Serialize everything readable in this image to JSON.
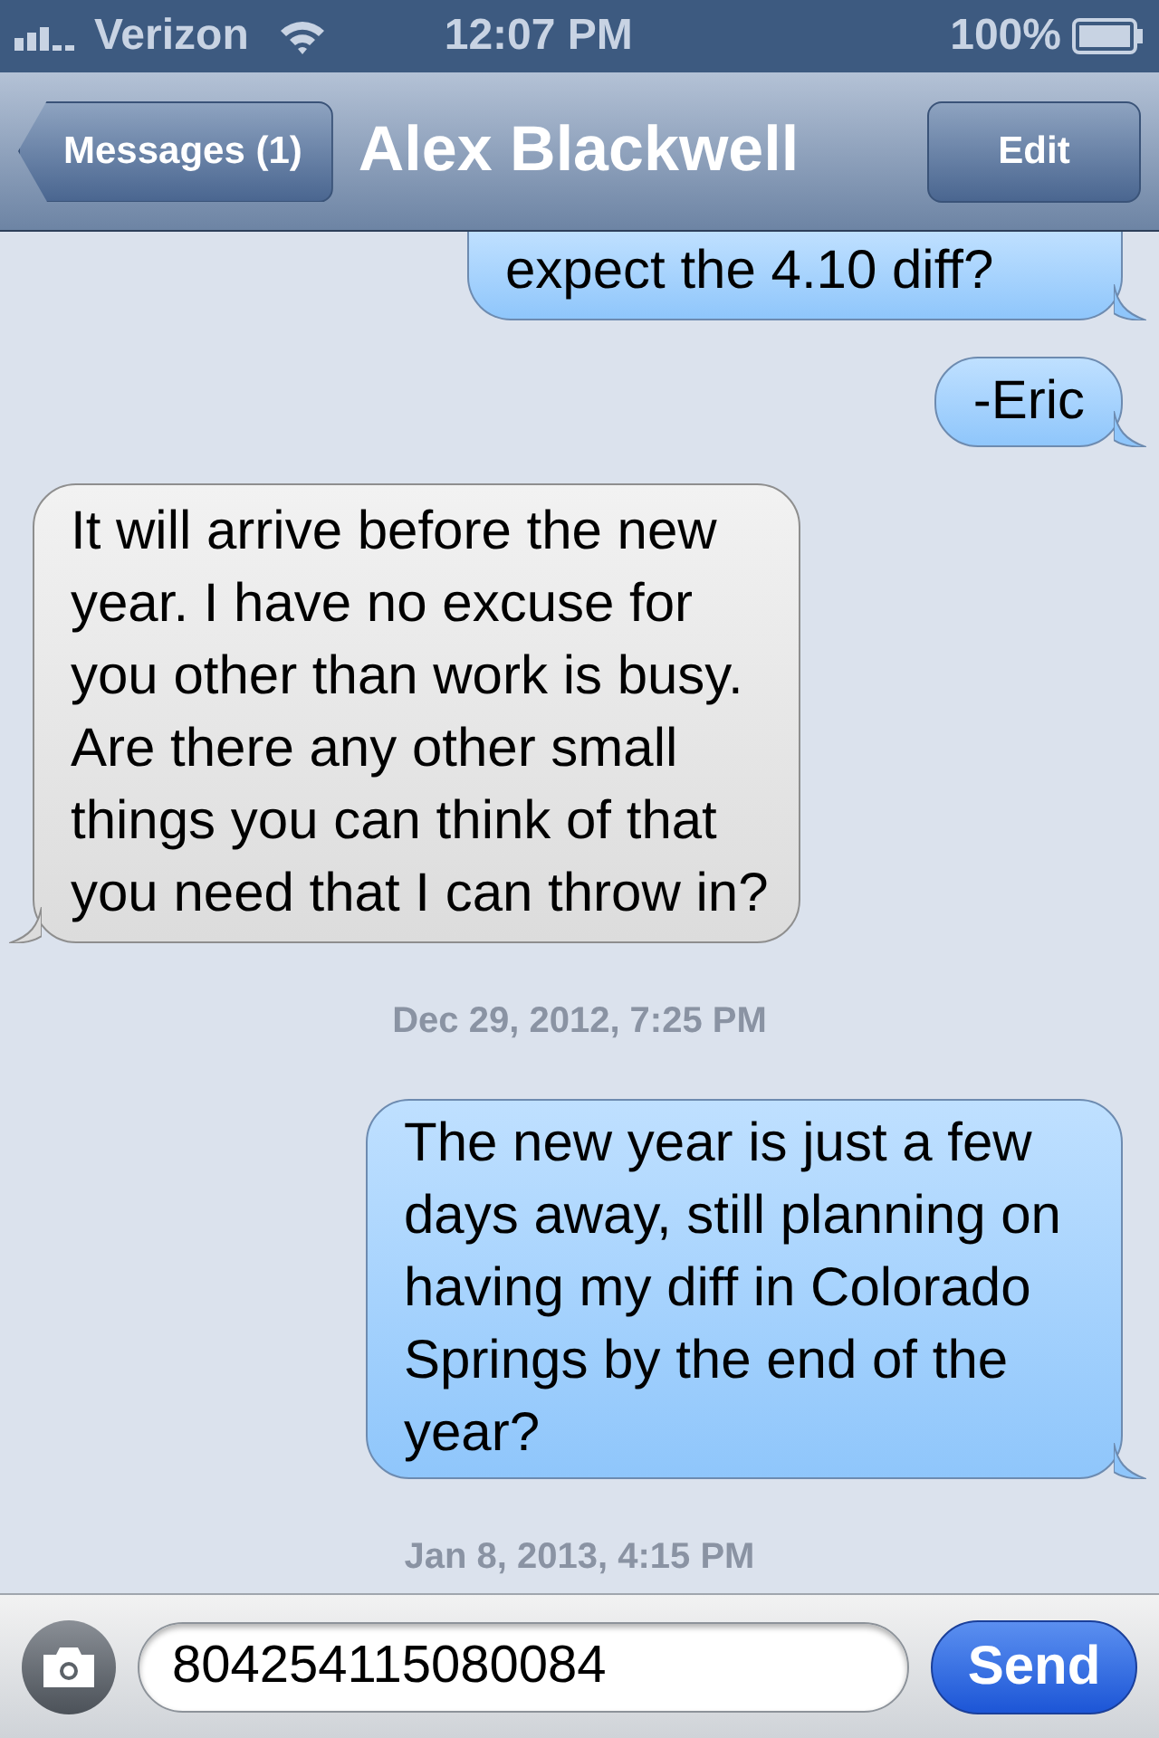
{
  "status_bar": {
    "carrier": "Verizon",
    "time": "12:07 PM",
    "battery": "100%"
  },
  "nav": {
    "back": "Messages (1)",
    "title": "Alex Blackwell",
    "edit": "Edit"
  },
  "messages": [
    {
      "kind": "sent",
      "text": "expect the 4.10 diff?",
      "cut": true
    },
    {
      "kind": "sent",
      "text": "-Eric"
    },
    {
      "kind": "received",
      "text": "It will arrive before the new year. I have no excuse for you other than work is busy. Are there any other small things you can think of that you need that I can throw in?"
    },
    {
      "kind": "timestamp",
      "text": "Dec 29, 2012, 7:25 PM"
    },
    {
      "kind": "sent",
      "text": "The new year is just a few days away, still planning on having my diff in Colorado Springs by the end of the year?"
    },
    {
      "kind": "timestamp",
      "text": "Jan 8, 2013, 4:15 PM"
    }
  ],
  "composer": {
    "value": "804254115080084",
    "send": "Send"
  }
}
